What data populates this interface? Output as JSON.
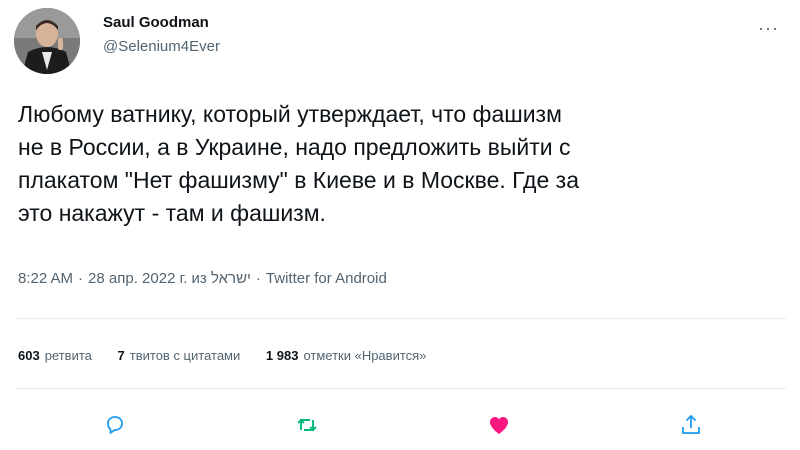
{
  "author": {
    "display_name": "Saul Goodman",
    "handle": "@Selenium4Ever"
  },
  "tweet": {
    "text": "Любому ватнику, который утверждает, что фашизм\nне в России, а в Украине, надо предложить выйти с\nплакатом \"Нет фашизму\" в Киеве и в Москве. Где за\nэто накажут - там и фашизм.",
    "time": "8:22 AM",
    "date": "28 апр. 2022 г. из ישראל",
    "source": "Twitter for Android",
    "separator": "·"
  },
  "stats": {
    "retweets_count": "603",
    "retweets_label": "ретвита",
    "quotes_count": "7",
    "quotes_label": "твитов с цитатами",
    "likes_count": "1 983",
    "likes_label": "отметки «Нравится»"
  },
  "icons": {
    "more": "more-icon",
    "reply": "reply-icon",
    "retweet": "retweet-icon",
    "like": "heart-icon",
    "share": "share-icon"
  },
  "colors": {
    "text": "#0f1419",
    "secondary": "#536471",
    "retweet_green": "#00ba7c",
    "like_pink": "#f91880",
    "reply_blue": "#1d9bf0"
  },
  "more_glyph": "···"
}
